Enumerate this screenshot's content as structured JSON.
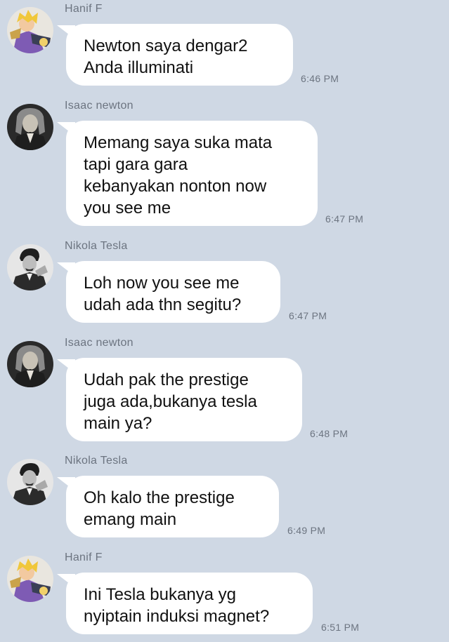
{
  "messages": [
    {
      "sender": "Hanif F",
      "avatar_icon": "anime-character-avatar-icon",
      "text": "Newton saya dengar2\nAnda illuminati",
      "time": "6:46 PM"
    },
    {
      "sender": "Isaac newton",
      "avatar_icon": "isaac-newton-portrait-icon",
      "text": "Memang saya suka mata\ntapi gara gara\nkebanyakan nonton now\nyou see me",
      "time": "6:47 PM"
    },
    {
      "sender": "Nikola Tesla",
      "avatar_icon": "nikola-tesla-portrait-icon",
      "text": "Loh now you see me\nudah ada thn segitu?",
      "time": "6:47 PM"
    },
    {
      "sender": "Isaac newton",
      "avatar_icon": "isaac-newton-portrait-icon",
      "text": "Udah pak the prestige\njuga ada,bukanya tesla\nmain ya?",
      "time": "6:48 PM"
    },
    {
      "sender": "Nikola Tesla",
      "avatar_icon": "nikola-tesla-portrait-icon",
      "text": "Oh kalo the prestige\nemang main",
      "time": "6:49 PM"
    },
    {
      "sender": "Hanif F",
      "avatar_icon": "anime-character-avatar-icon",
      "text": "Ini Tesla bukanya yg\nnyiptain induksi magnet?",
      "time": "6:51 PM"
    }
  ]
}
